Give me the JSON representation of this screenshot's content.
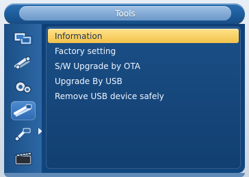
{
  "window": {
    "title": "Tools"
  },
  "sidebar": {
    "icons": [
      {
        "name": "network-icon"
      },
      {
        "name": "tools-icon"
      },
      {
        "name": "settings-icon"
      },
      {
        "name": "tools-selected-icon"
      },
      {
        "name": "usb-icon"
      },
      {
        "name": "media-icon"
      }
    ],
    "active_index": 3
  },
  "menu": {
    "items": [
      {
        "label": "Information"
      },
      {
        "label": "Factory setting"
      },
      {
        "label": "S/W Upgrade by OTA"
      },
      {
        "label": "Upgrade By USB"
      },
      {
        "label": "Remove USB device safely"
      }
    ],
    "selected_index": 0
  },
  "colors": {
    "selected_bg": "#f2c24a",
    "panel_bg": "#123f71",
    "text": "#eef6ff"
  }
}
